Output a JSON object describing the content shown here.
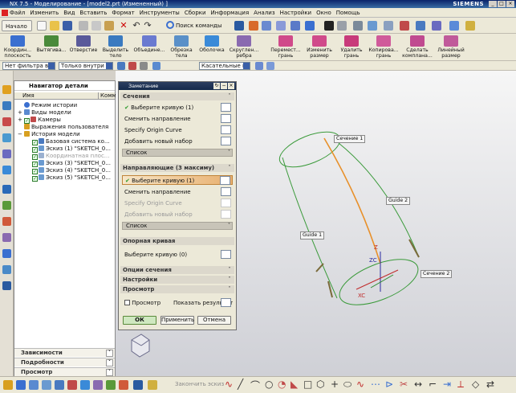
{
  "title": "NX 7.5 - Моделирование - [model2.prt (Измененный) ]",
  "brand": "SIEMENS",
  "menu": [
    "Файл",
    "Изменить",
    "Вид",
    "Вставить",
    "Формат",
    "Инструменты",
    "Сборки",
    "Информация",
    "Анализ",
    "Настройки",
    "Окно",
    "Помощь"
  ],
  "toolbar": {
    "start_label": "Начало",
    "search_label": "Поиск команды"
  },
  "feature_toolbar": [
    {
      "label": "Координ... плоскость",
      "color": "#3a6fd0"
    },
    {
      "label": "Вытягива...",
      "color": "#4a8a3a"
    },
    {
      "label": "Отверстие",
      "color": "#5a5a9a"
    },
    {
      "label": "Выделить тело",
      "color": "#3a7ac0"
    },
    {
      "label": "Объедине...",
      "color": "#6a7ad0"
    },
    {
      "label": "Обрезка тела",
      "color": "#5a90c8"
    },
    {
      "label": "Оболочка",
      "color": "#3a8ad8"
    },
    {
      "label": "Скруглен... ребра",
      "color": "#8a6ab0"
    },
    {
      "label": "Перемест... грань",
      "color": "#d04a8a"
    },
    {
      "label": "Изменить размер",
      "color": "#d04a8a"
    },
    {
      "label": "Удалить грань",
      "color": "#c83a7a"
    },
    {
      "label": "Копирова... грань",
      "color": "#d05a9a"
    },
    {
      "label": "Сделать компланa...",
      "color": "#c04a90"
    },
    {
      "label": "Линейный размер",
      "color": "#c05a9a"
    }
  ],
  "filters": {
    "filter1": "Нет фильтра выбо",
    "filter2": "Только внутри рабо",
    "filter3": "Касательные кривые"
  },
  "navigator": {
    "title": "Навигатор детали",
    "col_name": "Имя",
    "col_comment": "Комм",
    "items": [
      {
        "label": "Режим истории",
        "indent": 0
      },
      {
        "label": "Виды модели",
        "indent": 0
      },
      {
        "label": "Камеры",
        "indent": 0
      },
      {
        "label": "Выражения пользователя",
        "indent": 0
      },
      {
        "label": "История модели",
        "indent": 0
      },
      {
        "label": "Базовая система ко...",
        "indent": 1
      },
      {
        "label": "Эскиз (1) \"SKETCH_0...",
        "indent": 1
      },
      {
        "label": "Координатная плос...",
        "indent": 1,
        "dim": true
      },
      {
        "label": "Эскиз (3) \"SKETCH_0...",
        "indent": 1
      },
      {
        "label": "Эскиз (4) \"SKETCH_0...",
        "indent": 1
      },
      {
        "label": "Эскиз (5) \"SKETCH_0...",
        "indent": 1
      }
    ],
    "accordions": [
      "Зависимости",
      "Подробности",
      "Просмотр"
    ]
  },
  "dialog": {
    "title": "Заметание",
    "sections_header": "Сечения",
    "sec_select": "Выберите кривую (1)",
    "sec_reverse": "Сменить направление",
    "sec_origin": "Specify Origin Curve",
    "sec_add": "Добавить новый набор",
    "list_label": "Список",
    "guides_header": "Направляющие (3 максиму)",
    "g_select": "Выберите кривую (1)",
    "g_reverse": "Сменить направление",
    "g_origin": "Specify Origin Curve",
    "g_add": "Добавить новый набор",
    "guide_list": "Список",
    "spine_header": "Опорная кривая",
    "spine_select": "Выберите кривую (0)",
    "opt_header": "Опции сечения",
    "settings_header": "Настройки",
    "preview_header": "Просмотр",
    "preview_check": "Просмотр",
    "show_result": "Показать результат",
    "ok": "ОК",
    "apply": "Применить",
    "cancel": "Отмена"
  },
  "labels3d": {
    "sec1": "Сечение 1",
    "sec2": "Сечение 2",
    "guide1": "Guide 1",
    "guide2": "Guide 2",
    "axis_z": "Z",
    "axis_zc": "ZC",
    "axis_xc": "XC"
  },
  "status_hint": "Закончить эскиз"
}
